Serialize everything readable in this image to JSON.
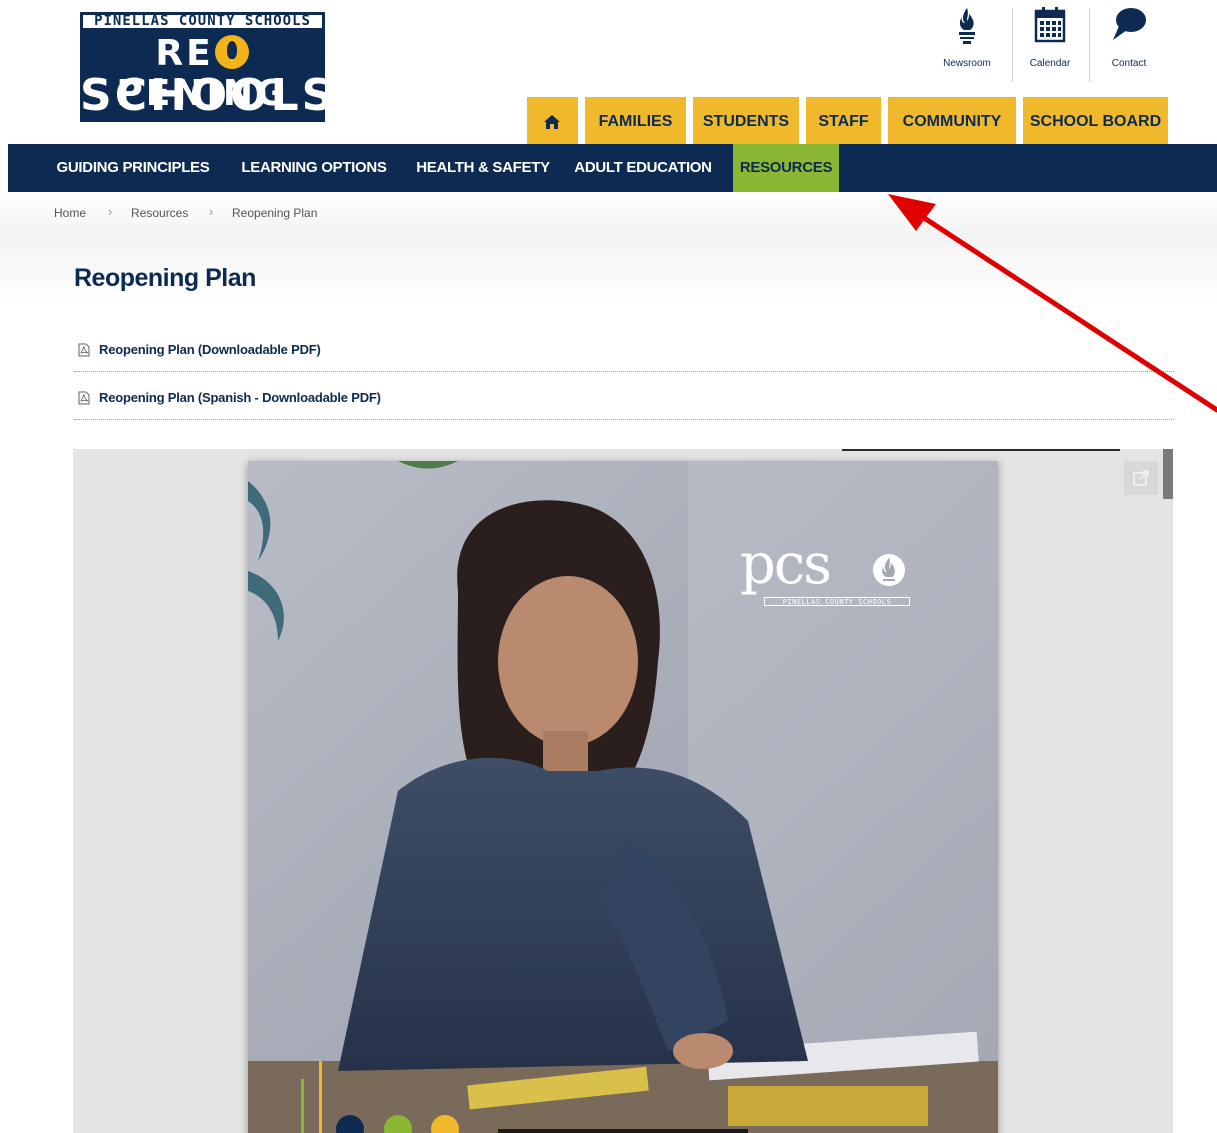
{
  "logo": {
    "line1": "PINELLAS COUNTY SCHOOLS",
    "line2_a": "RE",
    "line2_b": "PENING",
    "line3": "SCHOOLS"
  },
  "utility_links": [
    {
      "label": "Newsroom",
      "icon": "flame-icon"
    },
    {
      "label": "Calendar",
      "icon": "calendar-icon"
    },
    {
      "label": "Contact",
      "icon": "speech-bubble-icon"
    }
  ],
  "audience_tabs": {
    "home_icon": "home-icon",
    "items": [
      "FAMILIES",
      "STUDENTS",
      "STAFF",
      "COMMUNITY",
      "SCHOOL BOARD"
    ]
  },
  "main_nav": {
    "items": [
      "GUIDING PRINCIPLES",
      "LEARNING OPTIONS",
      "HEALTH & SAFETY",
      "ADULT EDUCATION",
      "RESOURCES"
    ],
    "active": "RESOURCES"
  },
  "breadcrumb": [
    "Home",
    "Resources",
    "Reopening Plan"
  ],
  "page": {
    "title": "Reopening Plan",
    "downloads": [
      {
        "label": "Reopening Plan (Downloadable PDF)",
        "icon": "pdf-icon"
      },
      {
        "label": "Reopening Plan (Spanish - Downloadable PDF)",
        "icon": "pdf-icon"
      }
    ]
  },
  "viewer": {
    "popout_icon": "external-link-icon",
    "cover_logo": "pcs",
    "cover_logo_sub": "PINELLAS COUNTY SCHOOLS"
  },
  "colors": {
    "navy": "#0c2a52",
    "gold": "#f0b92b",
    "green": "#8ab832",
    "annotation_arrow": "#e00000"
  }
}
